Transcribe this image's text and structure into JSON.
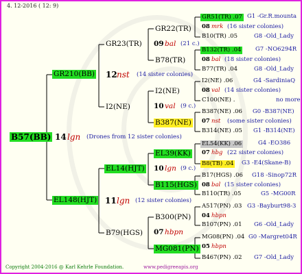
{
  "header_date": "4. 12-2016 ( 12: 9)",
  "copyright": "Copyright 2004-2016 @ Karl Kehrle Foundation.",
  "url": "www.pedigreeapis.org",
  "root": {
    "name": "B57(BB)"
  },
  "g1": {
    "sire_gen": "14",
    "sire_code": "lgn",
    "sire_note": "(Drones from 12 sister colonies)",
    "top": {
      "name": "GR210(BB)",
      "gen": "12",
      "code": "nst",
      "note": "(14 sister colonies)"
    },
    "bot": {
      "name": "EL148(HJT)",
      "gen": "11",
      "code": "lgn",
      "note": "(12 sister colonies)"
    }
  },
  "g2": {
    "a": {
      "name": "GR23(TR)",
      "gen": "09",
      "code": "bal",
      "note": "(21 c.)"
    },
    "b": {
      "name": "I2(NE)",
      "gen": "10",
      "code": "val",
      "note": "(9 c.)"
    },
    "c": {
      "name": "EL14(HJT)",
      "gen": "10",
      "code": "lgn",
      "note": "(9 c.)"
    },
    "d": {
      "name": "B79(HGS)",
      "gen": "07",
      "code": "hbpn"
    }
  },
  "g3": {
    "a1": "GR22(TR)",
    "a2": "B78(TR)",
    "b1": "I2(NE)",
    "b2": "B387(NE)",
    "c1": "EL39(KK)",
    "c2": "B115(HGS)",
    "d1": "B300(PN)",
    "d2": "MG081(PN)"
  },
  "g4": [
    {
      "label": "GR51(TR) .07",
      "hl": "g",
      "info": "G1 -Gr.R.mounta"
    },
    {
      "gen": "08",
      "code": "mrk",
      "note": "(16 sister colonies)"
    },
    {
      "label": "B10(TR) .05",
      "info": "G8 -Old_Lady"
    },
    {
      "label": "B132(TR) .04",
      "hl": "g",
      "info": "G7 -NO6294R"
    },
    {
      "gen": "08",
      "code": "bal",
      "note": "(18 sister colonies)"
    },
    {
      "label": "B77(TR) .04",
      "info": "G8 -Old_Lady"
    },
    {
      "label": "I2(NE) .06",
      "info": "G4 -SardiniaQ"
    },
    {
      "gen": "08",
      "code": "val",
      "note": "(14 sister colonies)"
    },
    {
      "label": "C100(NE) .",
      "info": "no more"
    },
    {
      "label": "B387(NE) .06",
      "info": "G0 -B387(NE)"
    },
    {
      "gen": "07",
      "code": "nst",
      "note": "(some sister colonies)"
    },
    {
      "label": "B314(NE) .05",
      "info": "G1 -B314(NE)"
    },
    {
      "label": "EL54(KK) .06",
      "hl": "gr",
      "info": "G4 -EO386"
    },
    {
      "gen": "07",
      "code": "hbg",
      "note": "(22 sister colonies)"
    },
    {
      "label": "B8(TB) .04",
      "hl": "y",
      "info": "G3 -E4(Skane-B)"
    },
    {
      "label": "B17(HGS) .06",
      "info": "G18 -Sinop72R"
    },
    {
      "gen": "08",
      "code": "bal",
      "note": "(15 sister colonies)"
    },
    {
      "label": "B110(TR) .05",
      "info": "G5 -MG00R"
    },
    {
      "label": "A517(PN) .03",
      "info": "G3 -Bayburt98-3"
    },
    {
      "gen": "04",
      "code": "hbpn"
    },
    {
      "label": "B107(PN) .01",
      "info": "G6 -Old_Lady"
    },
    {
      "label": "MG08(PN) .04",
      "info": "G0 -Margret04R"
    },
    {
      "gen": "05",
      "code": "hbpn"
    },
    {
      "label": "B467(PN) .02",
      "info": "G7 -Old_Lady"
    }
  ]
}
